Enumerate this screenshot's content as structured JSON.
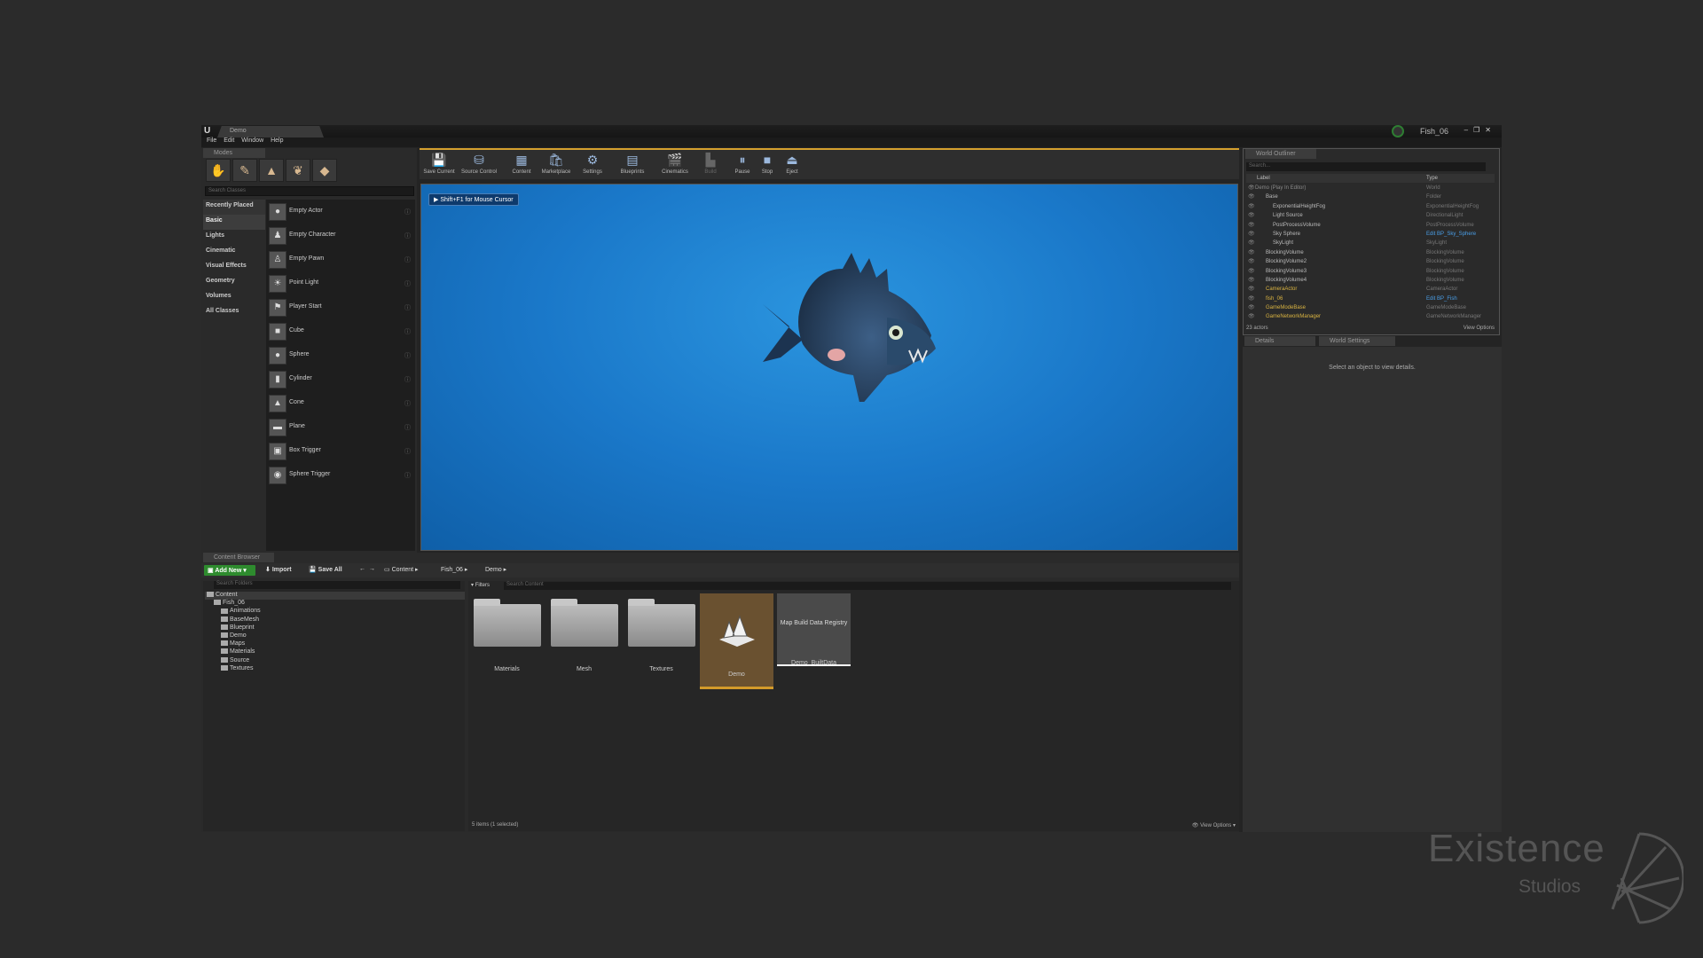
{
  "window": {
    "doc_tab": "Demo",
    "project_name": "Fish_06",
    "window_buttons": [
      "–",
      "❐",
      "✕"
    ]
  },
  "menu": [
    "File",
    "Edit",
    "Window",
    "Help"
  ],
  "modes": {
    "tab": "Modes",
    "search_placeholder": "Search Classes",
    "categories": [
      "Recently Placed",
      "Basic",
      "Lights",
      "Cinematic",
      "Visual Effects",
      "Geometry",
      "Volumes",
      "All Classes"
    ],
    "active_category": "Basic",
    "classes": [
      "Empty Actor",
      "Empty Character",
      "Empty Pawn",
      "Point Light",
      "Player Start",
      "Cube",
      "Sphere",
      "Cylinder",
      "Cone",
      "Plane",
      "Box Trigger",
      "Sphere Trigger"
    ]
  },
  "toolbar": {
    "buttons": [
      "Save Current",
      "Source Control",
      "Content",
      "Marketplace",
      "Settings",
      "Blueprints",
      "Cinematics",
      "Build",
      "Pause",
      "Stop",
      "Eject"
    ]
  },
  "viewport": {
    "hint": "Shift+F1 for Mouse Cursor"
  },
  "world_outliner": {
    "tab": "World Outliner",
    "search_placeholder": "Search...",
    "col_label": "Label",
    "col_type": "Type",
    "rows": [
      {
        "label": "Demo (Play In Editor)",
        "type": "World"
      },
      {
        "label": "Base",
        "type": "Folder"
      },
      {
        "label": "ExponentialHeightFog",
        "type": "ExponentialHeightFog"
      },
      {
        "label": "Light Source",
        "type": "DirectionalLight"
      },
      {
        "label": "PostProcessVolume",
        "type": "PostProcessVolume"
      },
      {
        "label": "Sky Sphere",
        "type": "Edit BP_Sky_Sphere"
      },
      {
        "label": "SkyLight",
        "type": "SkyLight"
      },
      {
        "label": "BlockingVolume",
        "type": "BlockingVolume"
      },
      {
        "label": "BlockingVolume2",
        "type": "BlockingVolume"
      },
      {
        "label": "BlockingVolume3",
        "type": "BlockingVolume"
      },
      {
        "label": "BlockingVolume4",
        "type": "BlockingVolume"
      },
      {
        "label": "CameraActor",
        "type": "CameraActor"
      },
      {
        "label": "fish_06",
        "type": "Edit BP_Fish"
      },
      {
        "label": "GameModeBase",
        "type": "GameModeBase"
      },
      {
        "label": "GameNetworkManager",
        "type": "GameNetworkManager"
      }
    ],
    "actor_count": "23 actors",
    "view_options": "View Options"
  },
  "details": {
    "tab_details": "Details",
    "tab_world_settings": "World Settings",
    "message": "Select an object to view details."
  },
  "content_browser": {
    "tab": "Content Browser",
    "add_new": "Add New",
    "import": "Import",
    "save_all": "Save All",
    "breadcrumbs": [
      "Content",
      "Fish_06",
      "Demo"
    ],
    "folder_search": "Search Folders",
    "content_search": "Search Content",
    "filters": "Filters",
    "tree": [
      {
        "name": "Content",
        "depth": 0
      },
      {
        "name": "Fish_06",
        "depth": 1
      },
      {
        "name": "Animations",
        "depth": 2
      },
      {
        "name": "BaseMesh",
        "depth": 2
      },
      {
        "name": "Blueprint",
        "depth": 2
      },
      {
        "name": "Demo",
        "depth": 2
      },
      {
        "name": "Maps",
        "depth": 2
      },
      {
        "name": "Materials",
        "depth": 2
      },
      {
        "name": "Source",
        "depth": 2
      },
      {
        "name": "Textures",
        "depth": 2
      }
    ],
    "assets": [
      {
        "name": "Materials",
        "kind": "folder"
      },
      {
        "name": "Mesh",
        "kind": "folder"
      },
      {
        "name": "Textures",
        "kind": "folder"
      },
      {
        "name": "Demo",
        "kind": "level",
        "selected": true
      },
      {
        "name": "Demo_BuiltData",
        "kind": "map-data",
        "thumb_text": "Map Build Data Registry"
      }
    ],
    "item_count": "5 items (1 selected)",
    "view_options": "View Options"
  },
  "watermark": {
    "line1": "Existence",
    "line2": "Studios"
  },
  "colors": {
    "accent": "#d5a02e",
    "add_new": "#2e8b2e",
    "viewport_water": "#1a78c9",
    "link_blue": "#4a9fe8"
  }
}
